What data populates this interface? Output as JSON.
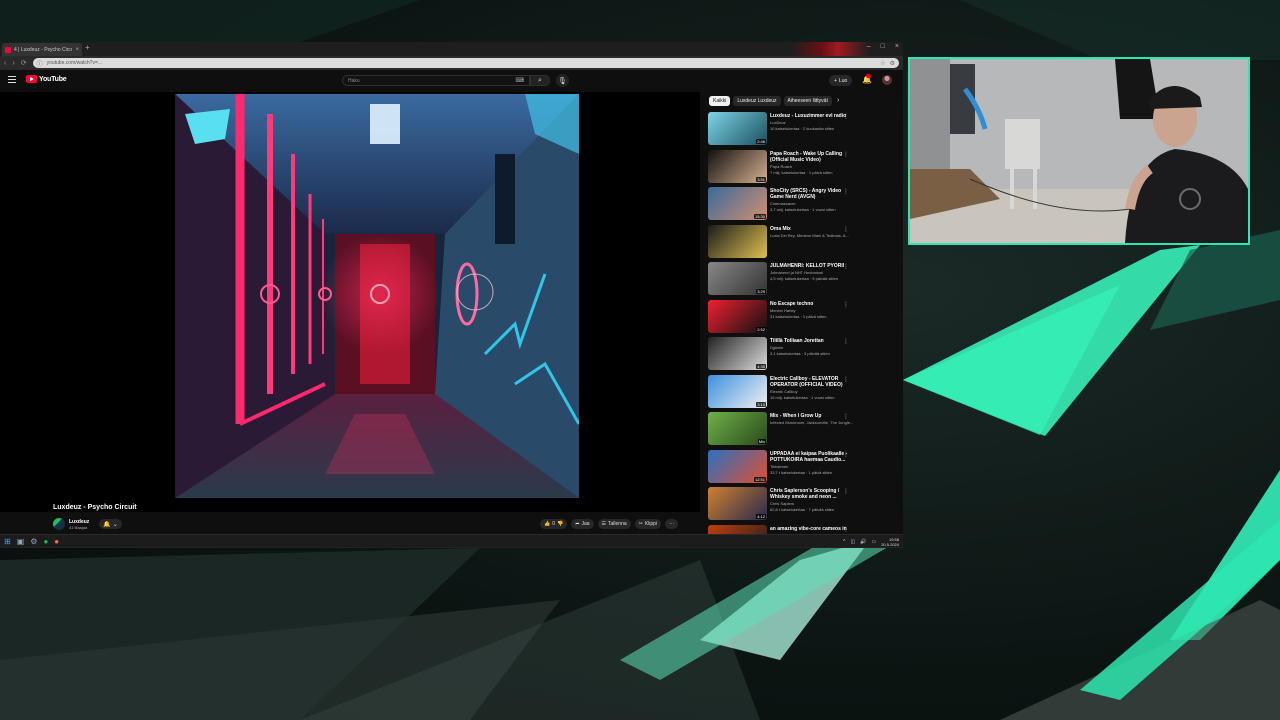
{
  "browser": {
    "tab_title": "4 | Luxdeuz - Psycho Circuit",
    "tab_close": "×",
    "new_tab": "+",
    "url": "youtube.com/watch?v=...",
    "window_controls": [
      "–",
      "□",
      "×"
    ]
  },
  "youtube": {
    "logo_text": "YouTube",
    "search_value": "Haku",
    "search_icon": "search-icon",
    "create_label": "Luo",
    "video": {
      "title": "Luxdeuz - Psycho Circuit",
      "channel": "Luxdeuz",
      "subscribers": "41 tilaajaa",
      "like_count": "0",
      "share_label": "Jaa",
      "save_label": "Tallenna",
      "clip_label": "Klippi",
      "more_label": "···"
    },
    "chips": [
      "Kaikki",
      "Luxdeuz Luxdeuz",
      "Aiheeseen liittyvät"
    ],
    "recommendations": [
      {
        "title": "Luxdeuz - Luxuzimmer evl radio",
        "channel": "LuxDeuz",
        "meta": "10 katselukertaa · 2 kuukautta sitten",
        "duration": "2:46"
      },
      {
        "title": "Papa Roach - Wake Up Calling (Official Music Video)",
        "channel": "Papa Roach",
        "meta": "7 milj. katselukertaa · 1 päivä sitten",
        "duration": "3:51"
      },
      {
        "title": "ShoCity (SRCS) - Angry Video Game Nerd (AVGN)",
        "channel": "Cinemassacre",
        "meta": "3,7 milj. katselukertaa · 1 vuosi sitten",
        "duration": "15:30"
      },
      {
        "title": "Oma Mix",
        "channel": "Luxia Del Rey, Medeon Mani & Tedimas, A...",
        "meta": "",
        "duration": ""
      },
      {
        "title": "JULMAHENRI: KELLOT PYÖRII",
        "channel": "Julmahenri ja NHT Hedonismi",
        "meta": "4,5 milj. katselukertaa · 9 päivää sitten",
        "duration": "3:29"
      },
      {
        "title": "No Escape techno",
        "channel": "Merwin Harley",
        "meta": "31 katselukertaa · 1 päivä sitten",
        "duration": "2:52"
      },
      {
        "title": "Tilillä Toiliaan Jorettan",
        "channel": "Djjamie",
        "meta": "3,1 katselukertaa · 3 päivää sitten",
        "duration": "4:35"
      },
      {
        "title": "Electric Callboy - ELEVATOR OPERATOR (OFFICIAL VIDEO)",
        "channel": "Electric Callboy",
        "meta": "19 milj. katselukertaa · 1 vuosi sitten",
        "duration": "3:10"
      },
      {
        "title": "Mix - When I Grow Up",
        "channel": "Infected Mushroom, Jacksonville, The Jungle...",
        "meta": "",
        "duration": "Mix"
      },
      {
        "title": "UPPADAA ei kaipaa Puolikaalle - POTTUKOIRA haemaa Caudio...",
        "channel": "Tiktokmen",
        "meta": "33,7 t katselukertaa · 1 päivä sitten",
        "duration": "12:51"
      },
      {
        "title": "Chris Saplerson's Scooping / Whiskey smoke and neon ...",
        "channel": "Chris Saplers",
        "meta": "62,8 t katselukertaa · 7 päivää sitten",
        "duration": "4:12"
      },
      {
        "title": "an amazing vibe-core cameos in",
        "channel": "",
        "meta": "",
        "duration": ""
      }
    ]
  },
  "taskbar": {
    "time": "19:58",
    "date": "20.5.2024"
  },
  "colors": {
    "accent": "#2ee6b4",
    "youtube_red": "#ff0033",
    "neon_pink": "#ff2a6d",
    "neon_cyan": "#31c6e8"
  }
}
